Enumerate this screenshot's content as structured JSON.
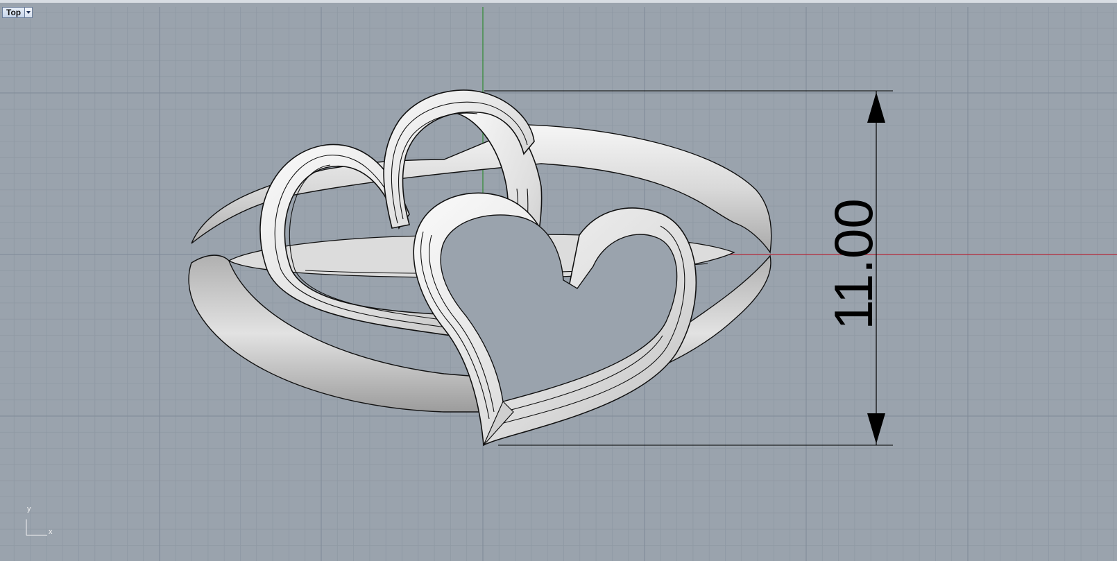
{
  "viewport": {
    "title": "Top",
    "dimension_value": "11.00",
    "axis_x_label": "x",
    "axis_y_label": "y"
  },
  "colors": {
    "background": "#9aa3ad",
    "grid_minor": "#8f99a4",
    "grid_major": "#7f8a96",
    "x_axis": "#b5283a",
    "y_axis": "#2f8a32",
    "model_fill": "#e9e9e9",
    "model_edge": "#111111"
  },
  "icons": {
    "viewport_menu": "chevron-down-icon",
    "axes_widget": "world-axes-icon"
  }
}
